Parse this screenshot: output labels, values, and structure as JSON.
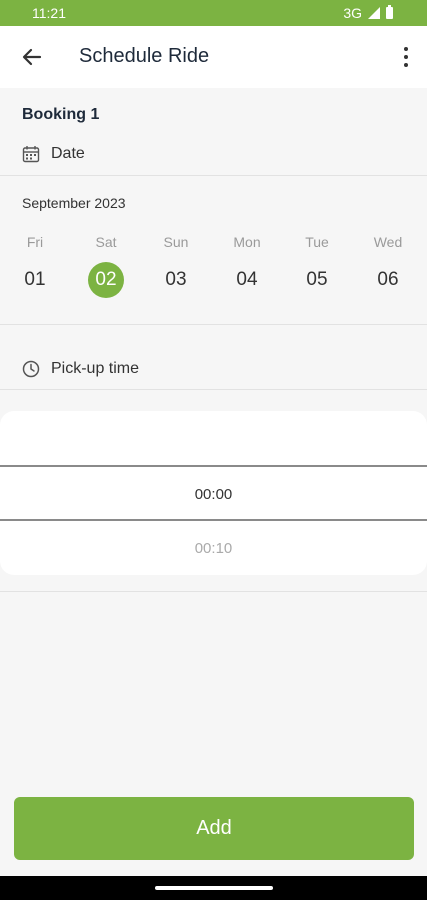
{
  "status_bar": {
    "time": "11:21",
    "network": "3G",
    "icons": [
      "signal-icon",
      "battery-icon"
    ]
  },
  "app_bar": {
    "title": "Schedule Ride",
    "back_icon": "arrow-left-icon",
    "menu_icon": "more-vert-icon"
  },
  "booking": {
    "title": "Booking 1",
    "date_label": "Date",
    "date_icon": "calendar-icon",
    "month": "September 2023",
    "days": [
      {
        "name": "Fri",
        "num": "01"
      },
      {
        "name": "Sat",
        "num": "02",
        "selected": true
      },
      {
        "name": "Sun",
        "num": "03"
      },
      {
        "name": "Mon",
        "num": "04"
      },
      {
        "name": "Tue",
        "num": "05"
      },
      {
        "name": "Wed",
        "num": "06"
      }
    ],
    "pickup_label": "Pick-up time",
    "pickup_icon": "clock-icon",
    "time_options": {
      "selected": "00:00",
      "next": "00:10"
    }
  },
  "add_button": {
    "label": "Add"
  },
  "colors": {
    "accent": "#7cb342",
    "background": "#f6f6f6",
    "title_text": "#1e2a3a"
  }
}
